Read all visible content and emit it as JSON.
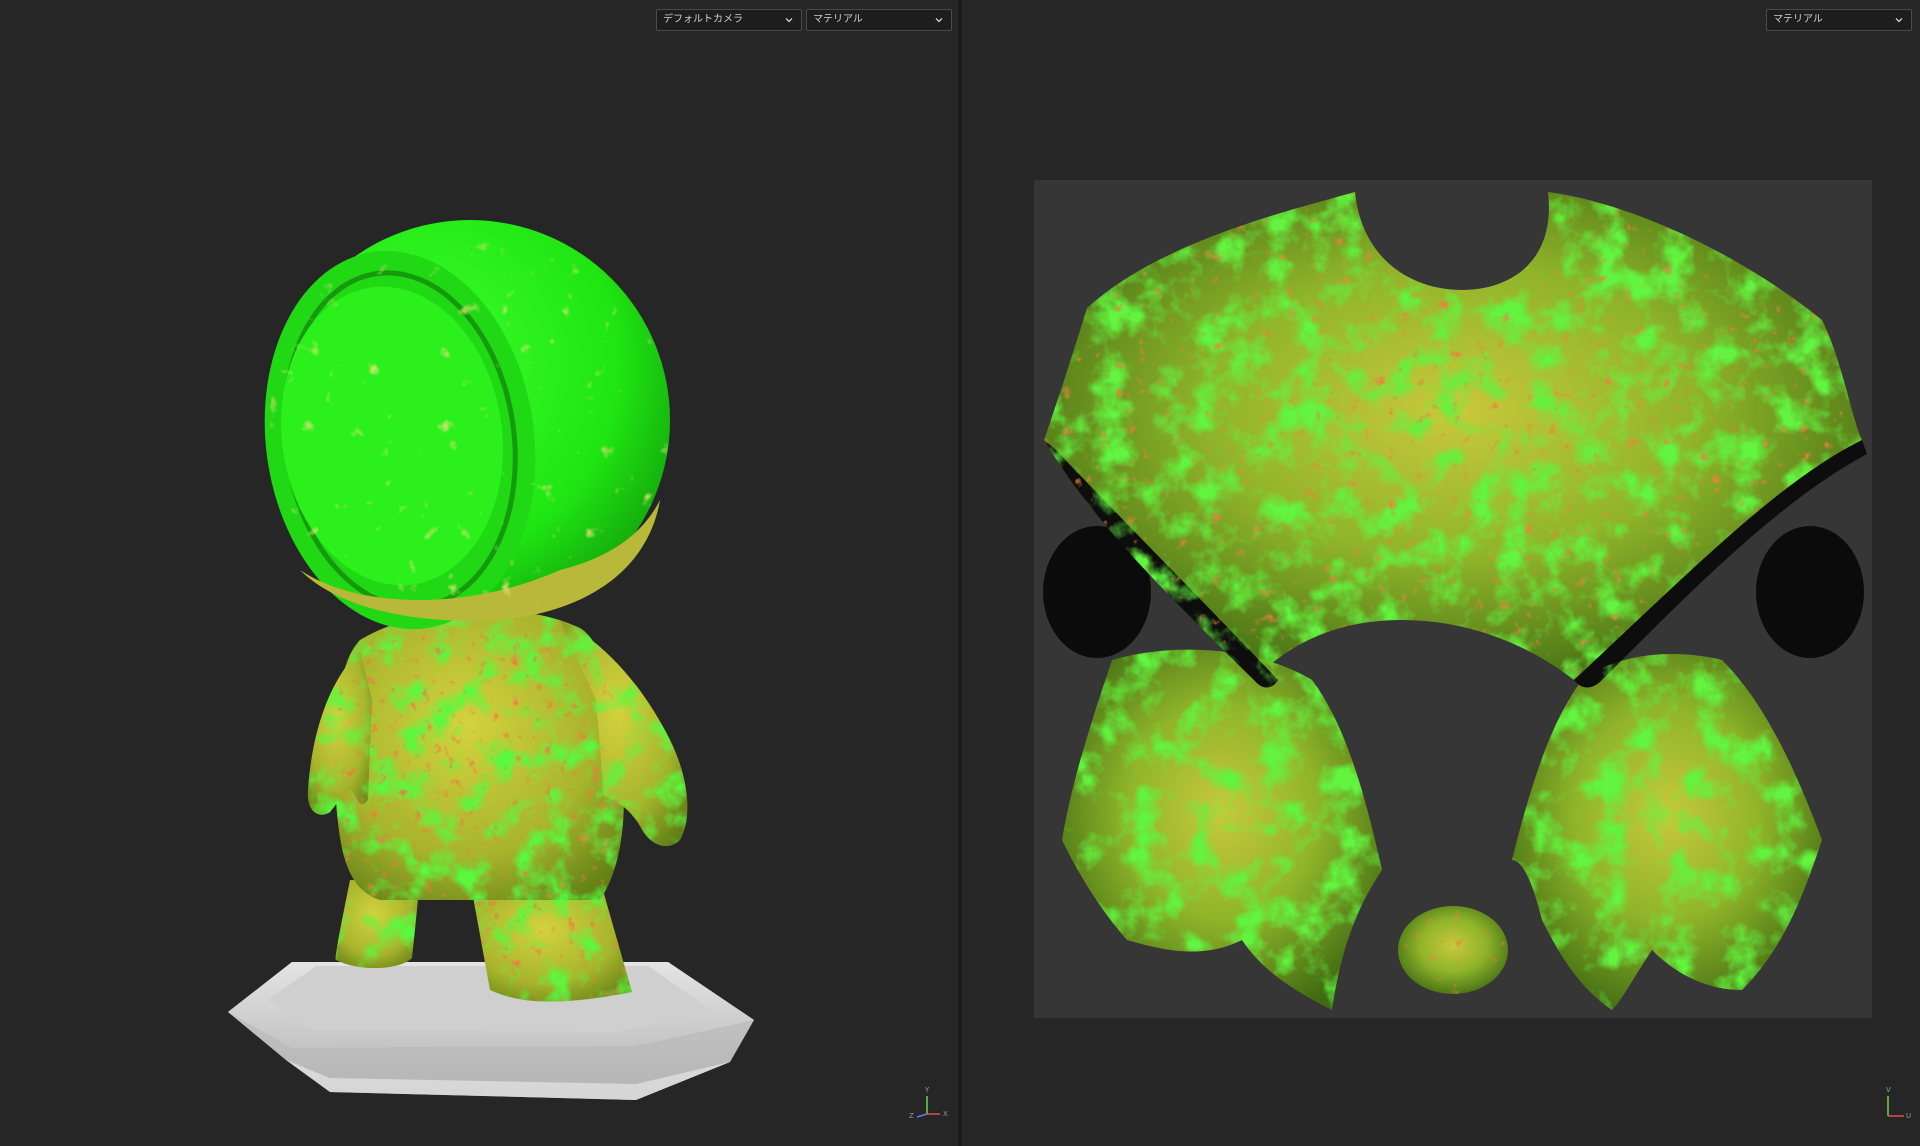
{
  "viewport_3d": {
    "camera_dropdown": {
      "value": "デフォルトカメラ"
    },
    "shading_dropdown": {
      "value": "マテリアル"
    },
    "gizmo": {
      "y": "Y",
      "z": "Z",
      "x": "X"
    }
  },
  "viewport_2d": {
    "shading_dropdown": {
      "value": "マテリアル"
    },
    "gizmo": {
      "v": "V",
      "u": "U"
    }
  },
  "colors": {
    "background": "#262626",
    "mask_green": "#1ff010",
    "mask_yellow": "#c8c83a",
    "mask_red": "#d0401a",
    "pedestal": "#d6d6d6",
    "uv_canvas": "#363636"
  },
  "icons": [
    "chevron-down-icon",
    "axis-gizmo-icon"
  ]
}
